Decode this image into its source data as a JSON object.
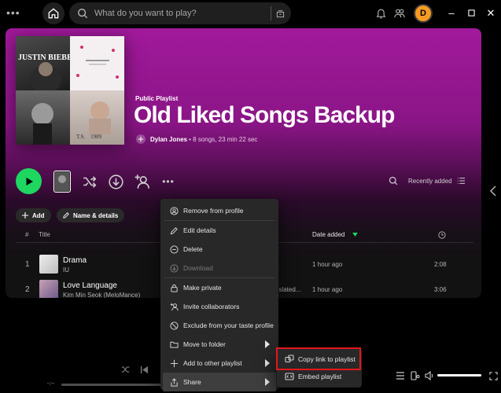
{
  "topbar": {
    "menu_dots": "•••",
    "search_placeholder": "What do you want to play?",
    "avatar_letter": "D"
  },
  "playlist": {
    "type": "Public Playlist",
    "title": "Old Liked Songs Backup",
    "owner": "Dylan Jones",
    "meta": " • 8 songs, 23 min 22 sec",
    "cover_text_1": "JUSTIN BIEBER",
    "cover_text_4": "T.S.    1989"
  },
  "actions": {
    "sort_label": "Recently added",
    "more_label": "•••"
  },
  "pills": {
    "add": "Add",
    "name_details": "Name & details"
  },
  "table": {
    "col_num": "#",
    "col_title": "Title",
    "col_added": "Date added",
    "rows": [
      {
        "num": "1",
        "title": "Drama",
        "artist": "IU",
        "album": "",
        "added": "1 hour ago",
        "duration": "2:08"
      },
      {
        "num": "2",
        "title": "Love Language",
        "artist": "Kim Min Seok (MeloMance)",
        "album": "nslated...",
        "added": "1 hour ago",
        "duration": "3:06"
      }
    ]
  },
  "player": {
    "time": "-:--"
  },
  "context_menu": {
    "items": [
      {
        "label": "Remove from profile",
        "icon": "profile-icon"
      },
      {
        "label": "Edit details",
        "icon": "pencil-icon"
      },
      {
        "label": "Delete",
        "icon": "minus-circle-icon"
      },
      {
        "label": "Download",
        "icon": "download-icon",
        "disabled": true
      },
      {
        "label": "Make private",
        "icon": "lock-icon"
      },
      {
        "label": "Invite collaborators",
        "icon": "add-user-icon"
      },
      {
        "label": "Exclude from your taste profile",
        "icon": "exclude-icon"
      },
      {
        "label": "Move to folder",
        "icon": "folder-icon"
      },
      {
        "label": "Add to other playlist",
        "icon": "plus-icon"
      },
      {
        "label": "Share",
        "icon": "share-icon"
      }
    ]
  },
  "share_submenu": {
    "copy_link": "Copy link to playlist",
    "embed": "Embed playlist"
  },
  "colors": {
    "accent_green": "#1ed760",
    "highlight_red": "#e3161b",
    "header_purple": "#a1199b"
  }
}
